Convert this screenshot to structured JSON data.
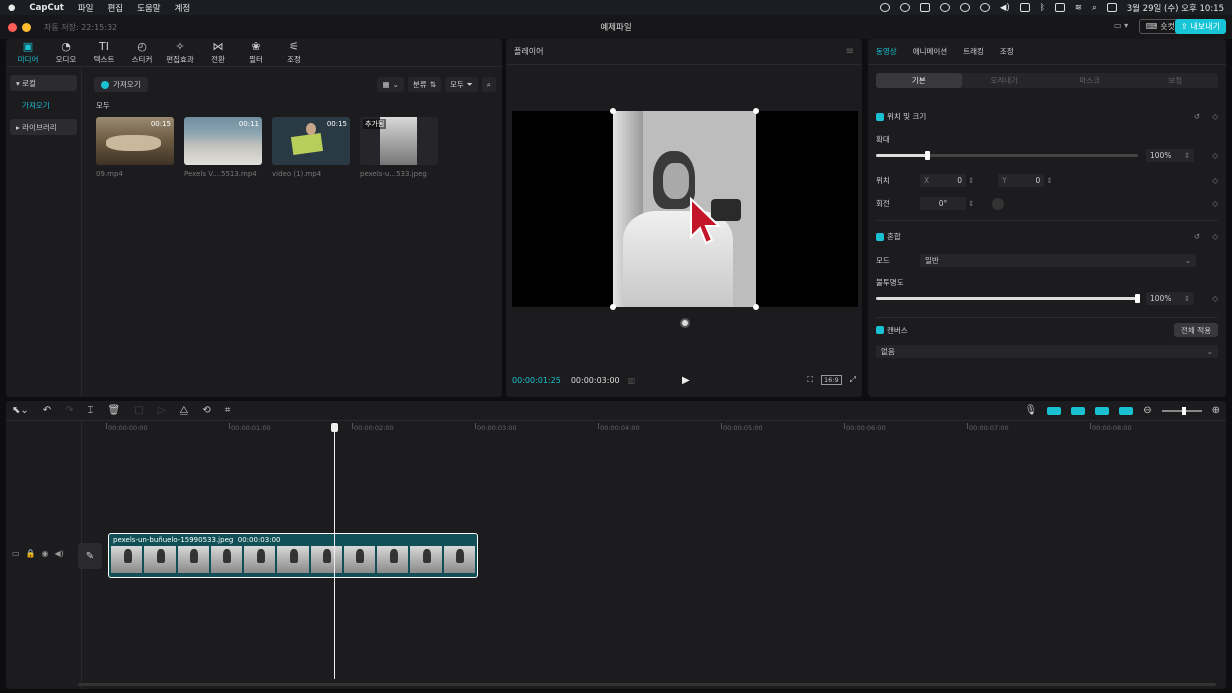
{
  "macbar": {
    "app": "CapCut",
    "menus": [
      "파일",
      "편집",
      "도움말",
      "계정"
    ],
    "datetime": "3월 29일 (수) 오후 10:15"
  },
  "window": {
    "autosave": "자동 저장: 22:15:32",
    "title": "예제파일",
    "shortcut_label": "숏컷",
    "export_label": "내보내기"
  },
  "media_tools": [
    {
      "label": "미디어",
      "icon": "media-icon",
      "active": true
    },
    {
      "label": "오디오",
      "icon": "audio-icon"
    },
    {
      "label": "텍스트",
      "icon": "text-icon"
    },
    {
      "label": "스티커",
      "icon": "sticker-icon"
    },
    {
      "label": "편집효과",
      "icon": "effects-icon"
    },
    {
      "label": "전환",
      "icon": "transition-icon"
    },
    {
      "label": "필터",
      "icon": "filter-icon"
    },
    {
      "label": "조정",
      "icon": "adjust-icon"
    }
  ],
  "media_sidebar": {
    "local": "로컬",
    "import_sub": "가져오기",
    "library": "라이브러리"
  },
  "media": {
    "import_label": "가져오기",
    "sort_label": "분류",
    "all_filter": "모두",
    "all_label": "모두",
    "items": [
      {
        "name": "09.mp4",
        "duration": "00:15",
        "badge": ""
      },
      {
        "name": "Pexels V....5513.mp4",
        "duration": "00:11",
        "badge": ""
      },
      {
        "name": "video (1).mp4",
        "duration": "00:15",
        "badge": ""
      },
      {
        "name": "pexels-u...533.jpeg",
        "duration": "",
        "badge": "추가됨"
      }
    ]
  },
  "player": {
    "title": "플레이어",
    "current_time": "00:00:01:25",
    "total_time": "00:00:03:00",
    "ratio": "16:9"
  },
  "props": {
    "tabs": [
      "동영상",
      "애니메이션",
      "트래킹",
      "조정"
    ],
    "subtabs": [
      "기본",
      "오려내기",
      "마스크",
      "보정"
    ],
    "position_size": {
      "title": "위치 및 크기",
      "scale_label": "확대",
      "scale_value": "100%",
      "scale_fraction": 0.2,
      "position_label": "위치",
      "x_label": "X",
      "x_value": "0",
      "y_label": "Y",
      "y_value": "0",
      "rotation_label": "회전",
      "rotation_value": "0°"
    },
    "blend": {
      "title": "혼합",
      "mode_label": "모드",
      "mode_value": "일반",
      "opacity_label": "불투명도",
      "opacity_value": "100%",
      "opacity_fraction": 1.0
    },
    "canvas": {
      "title": "캔버스",
      "apply_all": "전체 적용",
      "value": "없음"
    }
  },
  "timeline": {
    "ruler": [
      "00:00:00:00",
      "00:00:01:00",
      "00:00:02:00",
      "00:00:03:00",
      "00:00:04:00",
      "00:00:05:00",
      "00:00:06:00",
      "00:00:07:00",
      "00:00:08:00"
    ],
    "clip_name": "pexels-un-buñuelo-15990533.jpeg",
    "clip_duration": "00:00:03:00"
  },
  "colors": {
    "accent": "#19c1d3",
    "clip": "#0f4f55"
  }
}
